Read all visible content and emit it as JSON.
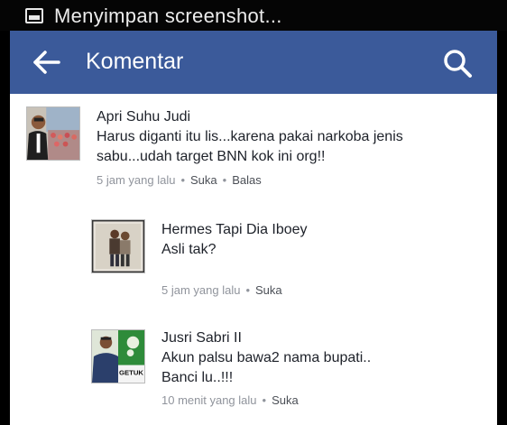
{
  "status_bar": {
    "icon": "image-icon",
    "text": "Menyimpan screenshot..."
  },
  "app_bar": {
    "title": "Komentar",
    "background": "#3b5a9a",
    "back_icon": "arrow-left-icon",
    "search_icon": "search-icon"
  },
  "comments": [
    {
      "author": "Apri Suhu Judi",
      "lines": [
        "Harus diganti itu lis...karena pakai narkoba jenis",
        "sabu...udah target BNN kok ini org!!"
      ],
      "time": "5 jam yang lalu",
      "like_label": "Suka",
      "reply_label": "Balas"
    },
    {
      "author": "Hermes Tapi Dia Iboey",
      "lines": [
        "Asli tak?"
      ],
      "time": "5 jam yang lalu",
      "like_label": "Suka"
    },
    {
      "author": "Jusri Sabri II",
      "lines": [
        "Akun palsu bawa2 nama bupati..",
        "Banci lu..!!!"
      ],
      "time": "10 menit yang lalu",
      "like_label": "Suka",
      "avatar_badge": "GETUK"
    }
  ]
}
